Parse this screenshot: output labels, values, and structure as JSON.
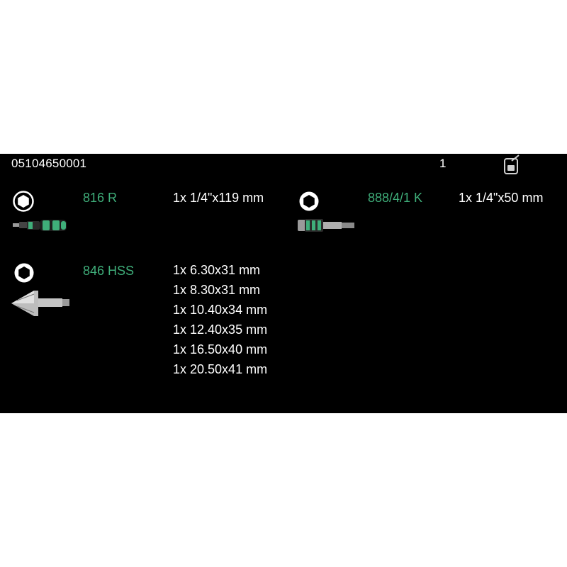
{
  "header": {
    "article_number": "05104650001",
    "quantity": "1",
    "box_icon": "packaging-box-icon"
  },
  "colors": {
    "background": "#000000",
    "product_name": "#3fae7a",
    "text": "#ffffff"
  },
  "items": [
    {
      "icon": "hex-socket-icon",
      "name": "816 R",
      "specs": [
        "1x 1/4\"x119 mm"
      ]
    },
    {
      "icon": "hex-socket-icon",
      "name": "888/4/1 K",
      "specs": [
        "1x 1/4\"x50 mm"
      ]
    },
    {
      "icon": "hex-socket-icon",
      "name": "846 HSS",
      "specs": [
        "1x 6.30x31 mm",
        "1x 8.30x31 mm",
        "1x 10.40x34 mm",
        "1x 12.40x35 mm",
        "1x 16.50x40 mm",
        "1x 20.50x41 mm"
      ]
    }
  ]
}
